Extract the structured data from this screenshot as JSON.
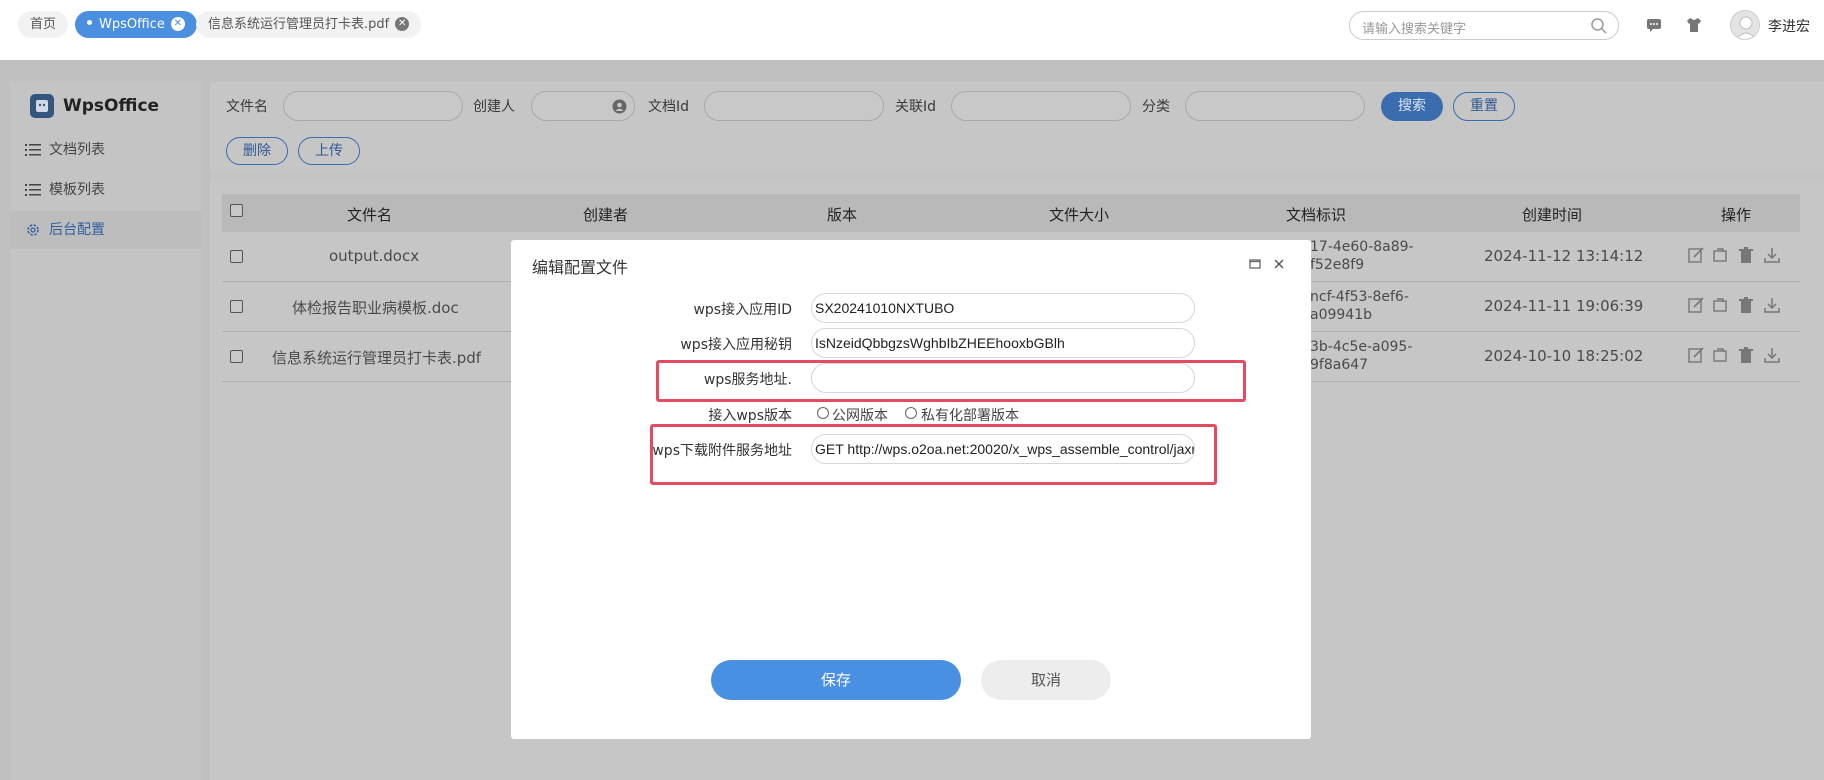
{
  "tabs": [
    {
      "label": "首页"
    },
    {
      "label": "WpsOffice"
    },
    {
      "label": "信息系统运行管理员打卡表.pdf"
    }
  ],
  "search": {
    "placeholder": "请输入搜索关键字"
  },
  "user": {
    "name": "李进宏"
  },
  "sidebar": {
    "title": "WpsOffice",
    "items": [
      {
        "label": "文档列表",
        "icon": "list-icon"
      },
      {
        "label": "模板列表",
        "icon": "list-icon"
      },
      {
        "label": "后台配置",
        "icon": "gear-icon"
      }
    ]
  },
  "filters": {
    "filename_label": "文件名",
    "creator_label": "创建人",
    "docid_label": "文档Id",
    "relid_label": "关联Id",
    "category_label": "分类",
    "search_button": "搜索",
    "reset_button": "重置",
    "delete_button": "删除",
    "upload_button": "上传"
  },
  "table": {
    "headers": [
      "文件名",
      "创建者",
      "版本",
      "文件大小",
      "文档标识",
      "创建时间",
      "操作"
    ],
    "rows": [
      {
        "filename": "output.docx",
        "id_line1": "17-4e60-8a89-",
        "id_line2": "f52e8f9",
        "created": "2024-11-12 13:14:12"
      },
      {
        "filename": "体检报告职业病模板.doc",
        "id_line1": "ncf-4f53-8ef6-",
        "id_line2": "a09941b",
        "created": "2024-11-11 19:06:39"
      },
      {
        "filename": "信息系统运行管理员打卡表.pdf",
        "id_line1": "3b-4c5e-a095-",
        "id_line2": "9f8a647",
        "created": "2024-10-10 18:25:02"
      }
    ]
  },
  "modal": {
    "title": "编辑配置文件",
    "fields": [
      {
        "label": "wps接入应用ID",
        "value": "SX20241010NXTUBO"
      },
      {
        "label": "wps接入应用秘钥",
        "value": "IsNzeidQbbgzsWghbIbZHEEhooxbGBlh"
      },
      {
        "label": "wps服务地址.",
        "value": ""
      },
      {
        "label": "接入wps版本",
        "value": ""
      },
      {
        "label": "wps下载附件服务地址",
        "value": "GET http://wps.o2oa.net:20020/x_wps_assemble_control/jaxr"
      }
    ],
    "radio_options": [
      "公网版本",
      "私有化部署版本"
    ],
    "save_button": "保存",
    "cancel_button": "取消"
  },
  "colors": {
    "accent": "#4a90e2",
    "highlight": "#e44a62"
  }
}
